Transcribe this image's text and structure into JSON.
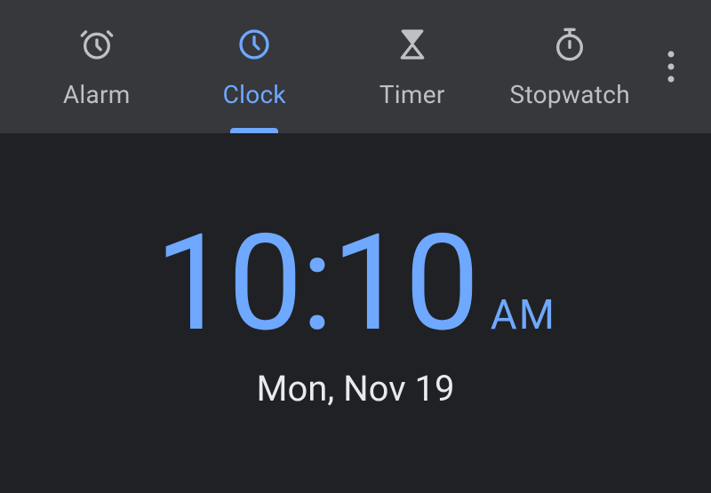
{
  "colors": {
    "accent": "#6fa8ff",
    "bgTabBar": "#36383c",
    "bgMain": "#202124",
    "textInactive": "#bdc1c6",
    "textDate": "#e8eaed"
  },
  "tabs": [
    {
      "icon": "alarm-icon",
      "label": "Alarm",
      "active": false
    },
    {
      "icon": "clock-icon",
      "label": "Clock",
      "active": true
    },
    {
      "icon": "timer-icon",
      "label": "Timer",
      "active": false
    },
    {
      "icon": "stopwatch-icon",
      "label": "Stopwatch",
      "active": false
    }
  ],
  "overflow_icon": "more-vert-icon",
  "clock": {
    "time": "10:10",
    "ampm": "AM",
    "date": "Mon, Nov 19"
  }
}
